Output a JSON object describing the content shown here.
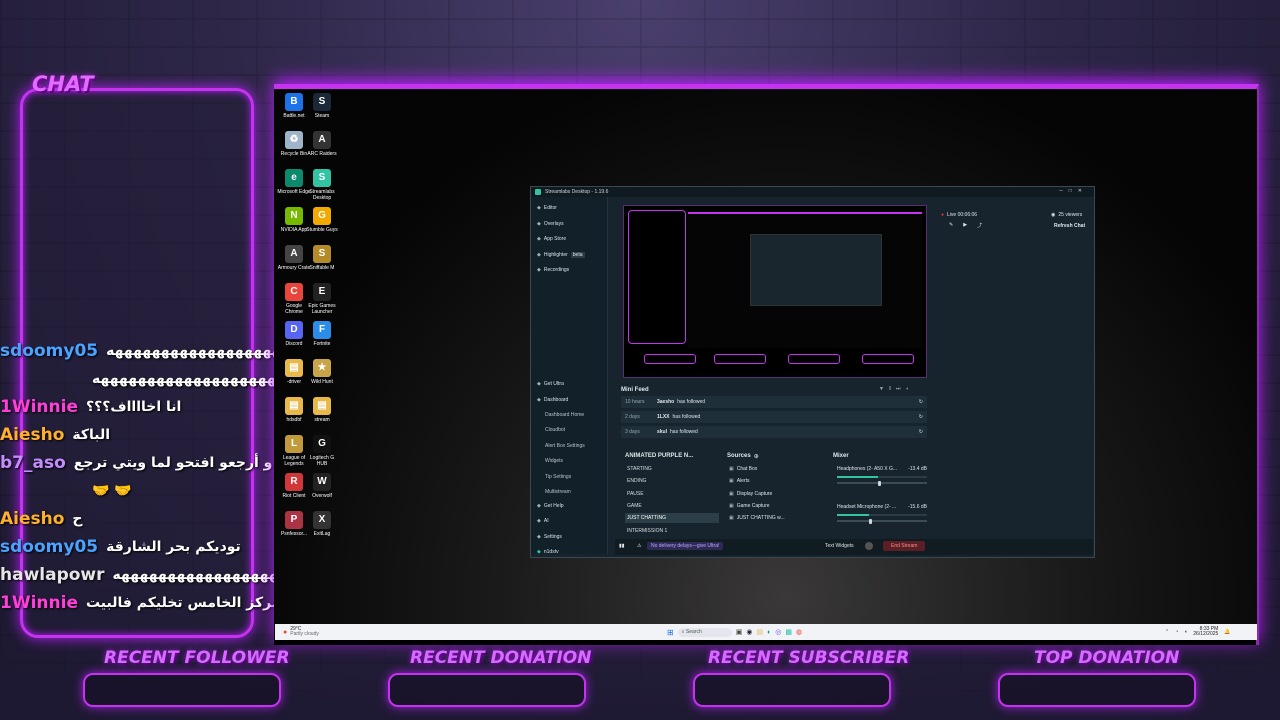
{
  "chat": {
    "title": "CHAT",
    "messages": [
      {
        "user": "sdoomy05",
        "color": "#4aa3ff",
        "text": "هههههههههههههههههههههههههههههههههه"
      },
      {
        "user": "",
        "color": "#ffffff",
        "text": "هههههههههههههههههههههههههه"
      },
      {
        "user": "1Winnie",
        "color": "#ff3fd9",
        "text": "انا اخااااف؟؟؟"
      },
      {
        "user": "Aiesho",
        "color": "#ffb12b",
        "text": "الباكة"
      },
      {
        "user": "b7_aso",
        "color": "#c58cff",
        "text": "كنتلو انت و أرجعو افتحو لما ويتي ترجع"
      },
      {
        "user": "",
        "color": "#ffffff",
        "text": "🤝 🤝"
      },
      {
        "user": "Aiesho",
        "color": "#ffb12b",
        "text": "ح"
      },
      {
        "user": "sdoomy05",
        "color": "#4aa3ff",
        "text": "توديكم بحر الشارقة"
      },
      {
        "user": "hawlapowr",
        "color": "#e6e6e6",
        "text": "هههههههههههههههههههههههههههههه"
      },
      {
        "user": "1Winnie",
        "color": "#ff3fd9",
        "text": "المركز الخامس تخليكم فالبيت"
      }
    ]
  },
  "desktop": {
    "icons": [
      {
        "label": "Battle.net",
        "color": "#1c73e8",
        "glyph": "B"
      },
      {
        "label": "Steam",
        "color": "#1b2838",
        "glyph": "S"
      },
      {
        "label": "Recycle Bin",
        "color": "#9fb4c8",
        "glyph": "♻"
      },
      {
        "label": "ARC Raiders",
        "color": "#333333",
        "glyph": "A"
      },
      {
        "label": "Microsoft Edge",
        "color": "#0b8a6e",
        "glyph": "e"
      },
      {
        "label": "Streamlabs Desktop",
        "color": "#31c3a2",
        "glyph": "S"
      },
      {
        "label": "NVIDIA App",
        "color": "#76b900",
        "glyph": "N"
      },
      {
        "label": "Stumble Guys",
        "color": "#f2a900",
        "glyph": "G"
      },
      {
        "label": "Armoury Crate",
        "color": "#444444",
        "glyph": "A"
      },
      {
        "label": "Sniffable M",
        "color": "#b58b2a",
        "glyph": "S"
      },
      {
        "label": "Google Chrome",
        "color": "#e8453c",
        "glyph": "C"
      },
      {
        "label": "Epic Games Launcher",
        "color": "#222222",
        "glyph": "E"
      },
      {
        "label": "Discord",
        "color": "#5865f2",
        "glyph": "D"
      },
      {
        "label": "Fortnite",
        "color": "#2b8de8",
        "glyph": "F"
      },
      {
        "label": "-driver",
        "color": "#e8b84a",
        "glyph": "▤"
      },
      {
        "label": "Wild Hunt",
        "color": "#c9a54a",
        "glyph": "★"
      },
      {
        "label": "hdsdbf",
        "color": "#e8b84a",
        "glyph": "▤"
      },
      {
        "label": "stream",
        "color": "#e8b84a",
        "glyph": "▤"
      },
      {
        "label": "League of Legends",
        "color": "#c19a3b",
        "glyph": "L"
      },
      {
        "label": "Logitech G HUB",
        "color": "#111111",
        "glyph": "G"
      },
      {
        "label": "Riot Client",
        "color": "#d13639",
        "glyph": "R"
      },
      {
        "label": "Overwolf",
        "color": "#222222",
        "glyph": "W"
      },
      {
        "label": "Psnfessor...",
        "color": "#aa3344",
        "glyph": "P"
      },
      {
        "label": "ExitLag",
        "color": "#333333",
        "glyph": "X"
      }
    ]
  },
  "taskbar": {
    "weather_temp": "29°C",
    "weather_desc": "Partly cloudy",
    "search_placeholder": "Search",
    "time": "8:33 PM",
    "date": "26/12/2025"
  },
  "streamlabs": {
    "title": "Streamlabs Desktop - 1.19.6",
    "sidebar": {
      "top": [
        "Editor",
        "Overlays",
        "App Store",
        "Highlighter",
        "Recordings"
      ],
      "highlighter_badge": "beta",
      "bottom": [
        "Get Ultra",
        "Dashboard"
      ],
      "dashboard_sub": [
        "Dashboard Home",
        "Cloudbot",
        "Alert Box Settings",
        "Widgets",
        "Tip Settings",
        "Multistream"
      ],
      "footer": [
        "Get Help",
        "AI",
        "Settings",
        "n1dstv"
      ]
    },
    "live": {
      "status": "Live 00:06:06",
      "viewers": "25 viewers",
      "refresh": "Refresh Chat"
    },
    "mini_feed": {
      "title": "Mini Feed",
      "items": [
        {
          "time": "10 hours",
          "name": "3aesho",
          "action": "has followed"
        },
        {
          "time": "2 days",
          "name": "1LXX",
          "action": "has followed"
        },
        {
          "time": "3 days",
          "name": "skul",
          "action": "has followed"
        }
      ]
    },
    "scenes": {
      "title": "ANIMATED PURPLE N...",
      "items": [
        "STARTING",
        "ENDING",
        "PAUSE",
        "GAME",
        "JUST CHATTING",
        "INTERMISSION 1"
      ],
      "active_index": 4
    },
    "sources": {
      "title": "Sources",
      "items": [
        "Chat Box",
        "Alerts",
        "Display Capture",
        "Game Capture",
        "JUST CHATTING w..."
      ]
    },
    "mixer": {
      "title": "Mixer",
      "channels": [
        {
          "name": "Headphones (2- A50 X G...",
          "db": "-13.4 dB",
          "level": 0.45
        },
        {
          "name": "Headset Microphone (2- ...",
          "db": "-15.6 dB",
          "level": 0.35
        }
      ]
    },
    "footer": {
      "promo": "No delivery delays—give Ultra!",
      "widgets": "Text Widgets",
      "end": "End Stream"
    }
  },
  "bottom_labels": [
    "RECENT FOLLOWER",
    "RECENT DONATION",
    "RECENT SUBSCRIBER",
    "TOP DONATION"
  ]
}
